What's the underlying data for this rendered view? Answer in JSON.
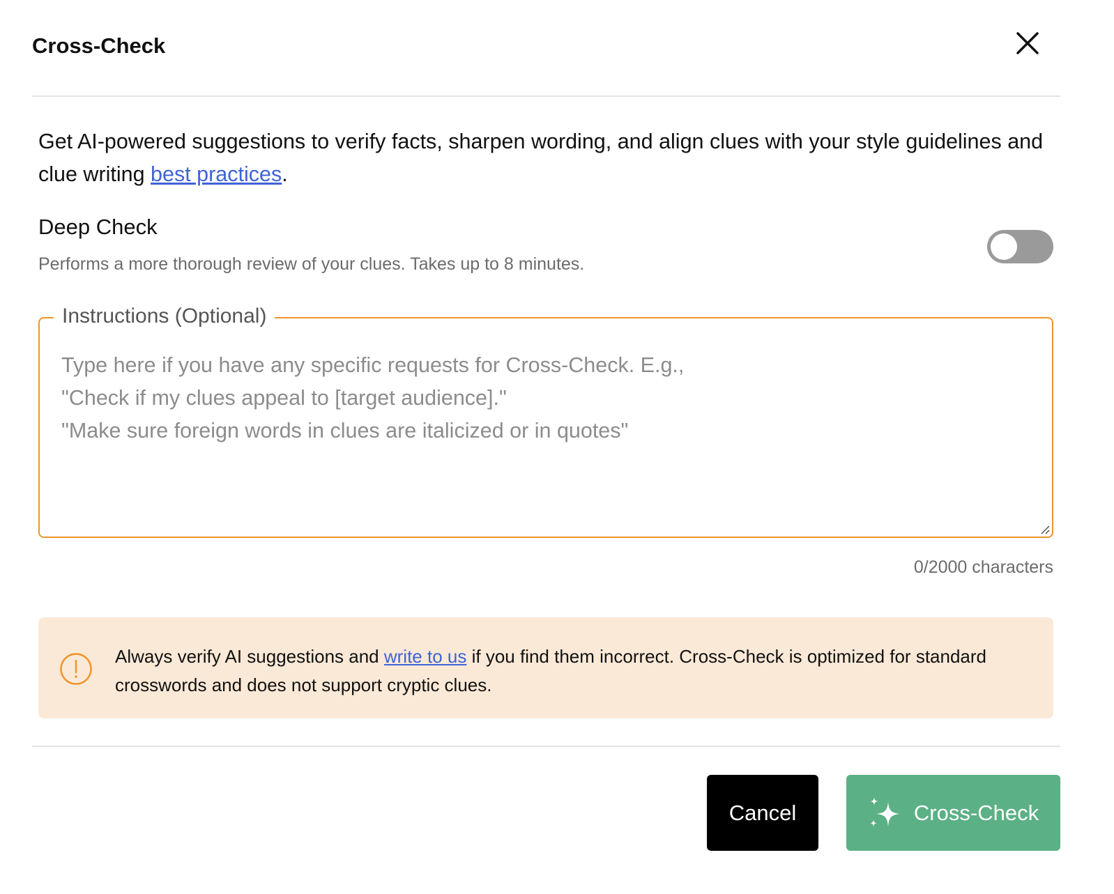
{
  "dialog": {
    "title": "Cross-Check",
    "close_icon": "close-icon"
  },
  "intro": {
    "text_before": "Get AI-powered suggestions to verify facts, sharpen wording, and align clues with your style guidelines and clue writing ",
    "link_label": "best practices",
    "text_after": "."
  },
  "deep_check": {
    "title": "Deep Check",
    "description": "Performs a more thorough review of your clues. Takes up to 8 minutes.",
    "enabled": false
  },
  "instructions": {
    "label": "Instructions (Optional)",
    "value": "",
    "placeholder": "Type here if you have any specific requests for Cross-Check. E.g.,\n\"Check if my clues appeal to [target audience].\"\n\"Make sure foreign words in clues are italicized or in quotes\"",
    "counter": "0/2000 characters"
  },
  "notice": {
    "icon": "warning-icon",
    "text_before": "Always verify AI suggestions and ",
    "link_label": "write to us",
    "text_after": " if you find them incorrect. Cross-Check is optimized for standard crosswords and does not support cryptic clues."
  },
  "actions": {
    "cancel_label": "Cancel",
    "primary_label": "Cross-Check",
    "primary_icon": "sparkle-icon"
  },
  "colors": {
    "accent_border": "#f0942b",
    "notice_bg": "#fbe9d7",
    "primary_button": "#5bb085",
    "link": "#3f63d6",
    "toggle_off": "#9a9a9a"
  }
}
